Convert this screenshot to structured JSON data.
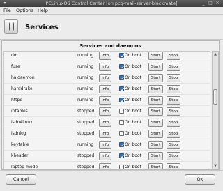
{
  "window": {
    "title": "PCLinuxOS Control Center  [on pcq-mail-server-blackmate]",
    "close_glyph": "×",
    "maximize_glyph": "□",
    "minimize_glyph": "_"
  },
  "menu": [
    "File",
    "Options",
    "Help"
  ],
  "header": {
    "title": "Services",
    "icon": "services-icon"
  },
  "panel": {
    "title": "Services and daemons"
  },
  "buttons": {
    "info": "Info",
    "start": "Start",
    "stop": "Stop",
    "on_boot": "On boot"
  },
  "services": [
    {
      "name": "dm",
      "status": "running",
      "on_boot": true
    },
    {
      "name": "fuse",
      "status": "running",
      "on_boot": true
    },
    {
      "name": "haldaemon",
      "status": "running",
      "on_boot": true
    },
    {
      "name": "harddrake",
      "status": "running",
      "on_boot": true
    },
    {
      "name": "httpd",
      "status": "running",
      "on_boot": true
    },
    {
      "name": "iptables",
      "status": "stopped",
      "on_boot": false
    },
    {
      "name": "isdn4linux",
      "status": "stopped",
      "on_boot": false
    },
    {
      "name": "isdnlog",
      "status": "stopped",
      "on_boot": false
    },
    {
      "name": "keytable",
      "status": "running",
      "on_boot": true
    },
    {
      "name": "kheader",
      "status": "stopped",
      "on_boot": true
    },
    {
      "name": "laptop-mode",
      "status": "stopped",
      "on_boot": false
    }
  ],
  "scrollbar": {
    "up_glyph": "▲",
    "down_glyph": "▼"
  },
  "footer": {
    "cancel": "Cancel",
    "ok": "Ok"
  },
  "colors": {
    "titlebar": "#4a4a4a",
    "checkbox_checked": "#3d6fb5"
  }
}
